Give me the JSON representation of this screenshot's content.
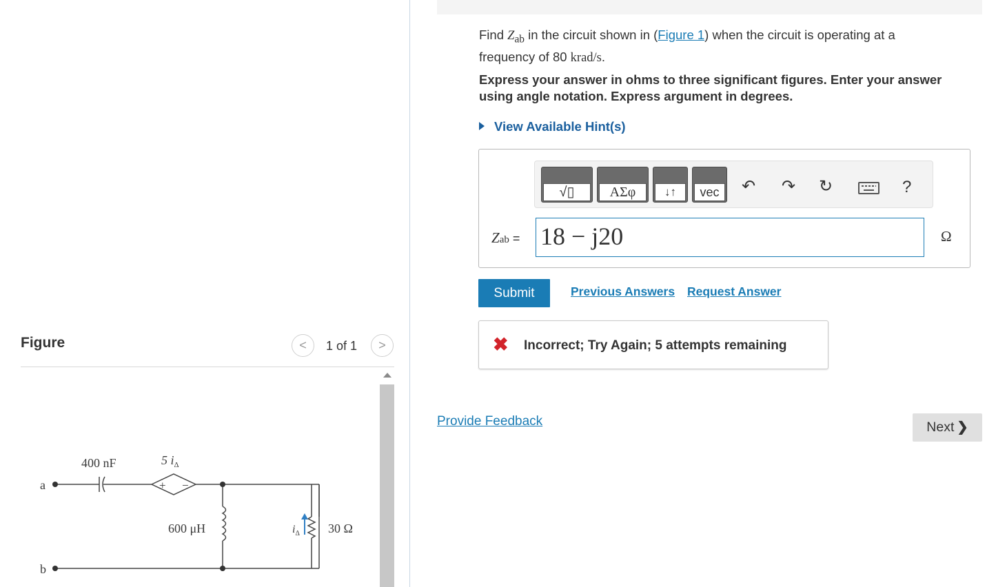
{
  "figure": {
    "title": "Figure",
    "pager": {
      "prev_icon": "chevron-left-icon",
      "next_icon": "chevron-right-icon",
      "count": "1 of 1"
    },
    "circuit": {
      "node_a": "a",
      "node_b": "b",
      "capacitor": "400 nF",
      "dependent_source": "5 i",
      "dependent_source_sub": "Δ",
      "source_plus": "+",
      "source_minus": "−",
      "inductor": "600 μH",
      "current": "i",
      "current_sub": "Δ",
      "resistor": "30 Ω"
    }
  },
  "question": {
    "text_before": "Find ",
    "var": "Z",
    "var_sub": "ab",
    "text_mid": " in the circuit shown in (",
    "figure_link": "Figure 1",
    "text_after": ") when the circuit is operating at a frequency of 80 ",
    "unit": "krad/s",
    "text_end": "."
  },
  "instructions": "Express your answer in ohms to three significant figures. Enter your answer using angle notation. Express argument in degrees.",
  "hint_link": "View Available Hint(s)",
  "toolbar": {
    "templates_label": "√▯",
    "greek_label": "ΑΣφ",
    "subsup_label": "↓↑",
    "vec_label": "vec",
    "undo_icon": "↶",
    "redo_icon": "↷",
    "reset_icon": "↻",
    "help_label": "?"
  },
  "answer": {
    "label_var": "Z",
    "label_sub": "ab",
    "label_eq": " =",
    "value": "18 − j20",
    "unit": "Ω"
  },
  "submit_label": "Submit",
  "previous_answers": "Previous Answers",
  "request_answer": "Request Answer",
  "feedback": {
    "icon": "✖",
    "message": "Incorrect; Try Again; 5 attempts remaining",
    "color": "#d2232a"
  },
  "provide_feedback": "Provide Feedback",
  "next_label": "Next",
  "next_icon": "❯",
  "colors": {
    "accent": "#1a7cb5",
    "error": "#d2232a"
  }
}
